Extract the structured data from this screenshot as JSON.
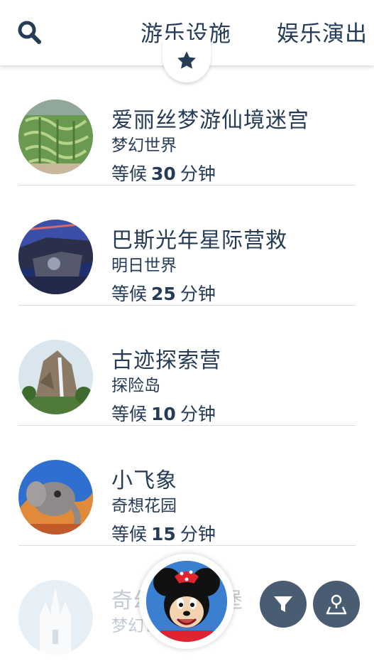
{
  "header": {
    "search_icon": "search-icon",
    "tabs": [
      {
        "label": "游乐设施"
      },
      {
        "label": "娱乐演出"
      }
    ],
    "favorites_icon": "star-icon"
  },
  "attractions": [
    {
      "name": "爱丽丝梦游仙境迷宫",
      "land": "梦幻世界",
      "wait_prefix": "等候",
      "wait_minutes": "30",
      "wait_unit": "分钟"
    },
    {
      "name": "巴斯光年星际营救",
      "land": "明日世界",
      "wait_prefix": "等候",
      "wait_minutes": "25",
      "wait_unit": "分钟"
    },
    {
      "name": "古迹探索营",
      "land": "探险岛",
      "wait_prefix": "等候",
      "wait_minutes": "10",
      "wait_unit": "分钟"
    },
    {
      "name": "小飞象",
      "land": "奇想花园",
      "wait_prefix": "等候",
      "wait_minutes": "15",
      "wait_unit": "分钟"
    },
    {
      "name": "奇幻童话城堡",
      "land": "梦幻世界"
    }
  ],
  "buttons": {
    "character_icon": "minnie-mouse-icon",
    "filter_icon": "filter-icon",
    "map_icon": "map-pin-icon"
  },
  "colors": {
    "text": "#253b56",
    "button": "#4a5c71",
    "divider": "#dcdcdc"
  }
}
